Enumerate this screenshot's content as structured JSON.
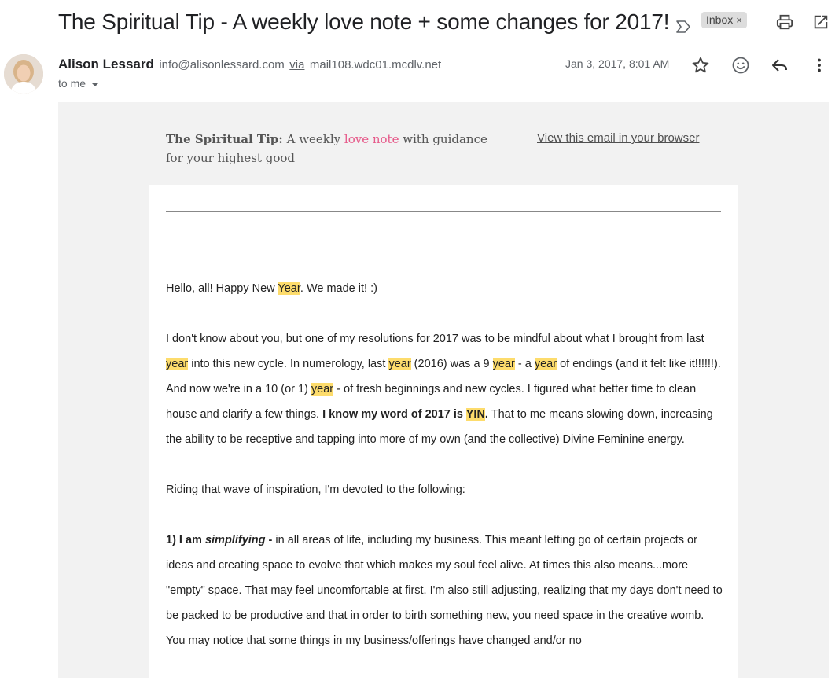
{
  "email": {
    "subject": "The Spiritual Tip - A weekly love note + some changes for 2017!",
    "label": "Inbox",
    "label_close": "×",
    "sender_name": "Alison Lessard",
    "sender_email": "info@alisonlessard.com",
    "via_label": "via",
    "via_host": "mail108.wdc01.mcdlv.net",
    "recipient": "to me",
    "date": "Jan 3, 2017, 8:01 AM"
  },
  "preheader": {
    "brand": "The Spiritual Tip:",
    "text_a": " A weekly ",
    "pink": "love note",
    "text_b": " with guidance for your highest good",
    "browser_link": "View this email in your browser"
  },
  "body": {
    "p1": {
      "a": "Hello, all! Happy New ",
      "h1": "Year",
      "b": ". We made it! :)"
    },
    "p2": {
      "a": "I don't know about you, but one of my resolutions for 2017 was to be mindful about what I brought from last ",
      "h1": "year",
      "b": " into this new cycle. In numerology, last ",
      "h2": "year",
      "c": " (2016) was a 9 ",
      "h3": "year",
      "d": " - a ",
      "h4": "year",
      "e": " of endings (and it felt like it!!!!!!). And now we're in a 10 (or 1) ",
      "h5": "year",
      "f": " - of fresh beginnings and new cycles. I figured what better time to clean house and clarify a few things. ",
      "bold": "I know my word of 2017 is ",
      "bold_h": "YIN",
      "bold_end": ".",
      "g": " That to me means slowing down, increasing the ability to be receptive and tapping into more of my own (and the collective) Divine Feminine energy."
    },
    "p3": "Riding that wave of inspiration, I'm devoted to the following:",
    "p4": {
      "bold": "1) I am ",
      "bold_italic": "simplifying",
      "bold_end": " - ",
      "a": "in all areas of life, including my business. This meant letting go of certain projects or ideas and creating space to evolve that which makes my soul feel alive. At times this also means...more \"empty\" space. That may feel uncomfortable at first. I'm also still adjusting, realizing that my days don't need to be packed to be productive and that in order to birth something new, you need space in the creative womb.  You may notice that some things in my business/offerings have changed and/or no"
    }
  },
  "icons": [
    "importance-marker-icon",
    "print-icon",
    "open-in-new-window-icon",
    "star-icon",
    "emoji-icon",
    "reply-icon",
    "more-vert-icon",
    "chevron-down-icon"
  ]
}
